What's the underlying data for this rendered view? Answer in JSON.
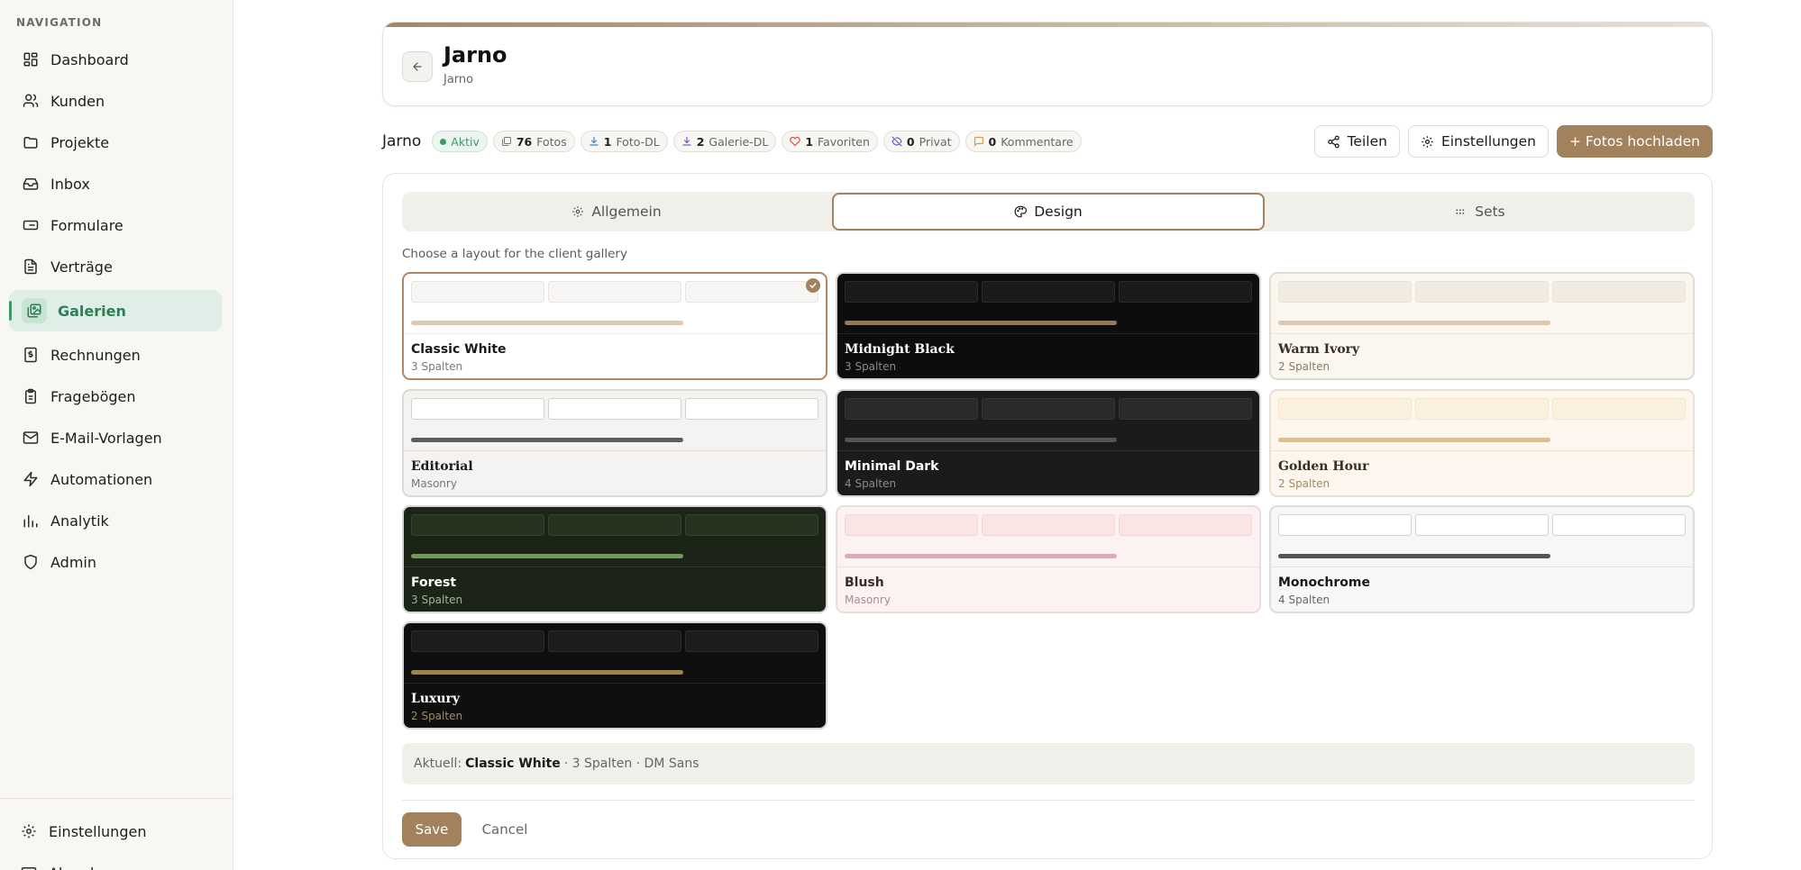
{
  "sidebar": {
    "heading": "NAVIGATION",
    "items": [
      {
        "label": "Dashboard",
        "icon": "dashboard-icon"
      },
      {
        "label": "Kunden",
        "icon": "users-icon"
      },
      {
        "label": "Projekte",
        "icon": "folder-icon"
      },
      {
        "label": "Inbox",
        "icon": "inbox-icon"
      },
      {
        "label": "Formulare",
        "icon": "form-icon"
      },
      {
        "label": "Verträge",
        "icon": "document-icon"
      },
      {
        "label": "Galerien",
        "icon": "gallery-icon",
        "active": true
      },
      {
        "label": "Rechnungen",
        "icon": "invoice-icon"
      },
      {
        "label": "Fragebögen",
        "icon": "clipboard-icon"
      },
      {
        "label": "E-Mail-Vorlagen",
        "icon": "mail-icon"
      },
      {
        "label": "Automationen",
        "icon": "lightning-icon"
      },
      {
        "label": "Analytik",
        "icon": "chart-icon"
      },
      {
        "label": "Admin",
        "icon": "shield-icon"
      }
    ],
    "bottom_items": [
      {
        "label": "Einstellungen",
        "icon": "gear-icon"
      },
      {
        "label": "Abrechnung",
        "icon": "billing-icon"
      }
    ]
  },
  "header": {
    "title": "Jarno",
    "subtitle": "Jarno"
  },
  "gallery": {
    "name": "Jarno",
    "status": "Aktiv",
    "stats": [
      {
        "count": "76",
        "label": "Fotos",
        "icon": "photos-icon",
        "color": "#777777"
      },
      {
        "count": "1",
        "label": "Foto-DL",
        "icon": "download-icon",
        "color": "#4a7fc7"
      },
      {
        "count": "2",
        "label": "Galerie-DL",
        "icon": "download-icon",
        "color": "#7a5fc0"
      },
      {
        "count": "1",
        "label": "Favoriten",
        "icon": "heart-icon",
        "color": "#d9534f"
      },
      {
        "count": "0",
        "label": "Privat",
        "icon": "eye-off-icon",
        "color": "#6a5fc0"
      },
      {
        "count": "0",
        "label": "Kommentare",
        "icon": "comment-icon",
        "color": "#d4a04a"
      }
    ]
  },
  "actions": {
    "share": "Teilen",
    "settings": "Einstellungen",
    "upload": "+ Fotos hochladen"
  },
  "tabs": [
    {
      "label": "Allgemein",
      "icon": "gear-icon"
    },
    {
      "label": "Design",
      "icon": "palette-icon",
      "active": true
    },
    {
      "label": "Sets",
      "icon": "grid-icon"
    }
  ],
  "design": {
    "hint": "Choose a layout for the client gallery",
    "themes": [
      {
        "name": "Classic White",
        "sub": "3 Spalten",
        "selected": true,
        "serif": false,
        "bg": "#ffffff",
        "cell": "#f6f5f3",
        "cell_border": "#e8e5e0",
        "bar": "#dcc9b3",
        "text": "#1a1a1a",
        "subtext": "#777777",
        "border": "#b08764",
        "divider": "#eeeeee"
      },
      {
        "name": "Midnight Black",
        "sub": "3 Spalten",
        "serif": true,
        "bg": "#0d0d0d",
        "cell": "#1a1a1a",
        "cell_border": "#2a2a2a",
        "bar": "#8f7a5c",
        "text": "#ffffff",
        "subtext": "#8a8a8a",
        "border": "#d6d6d6",
        "divider": "#262626"
      },
      {
        "name": "Warm Ivory",
        "sub": "2 Spalten",
        "serif": true,
        "bg": "#faf6f0",
        "cell": "#f1ebe1",
        "cell_border": "#e9e1d4",
        "bar": "#dbc8b0",
        "text": "#3a2e22",
        "subtext": "#8a7a66",
        "border": "#e1dccf",
        "divider": "#ece5d9"
      },
      {
        "name": "Editorial",
        "sub": "Masonry",
        "serif": true,
        "bg": "#f4f3f1",
        "cell": "#ffffff",
        "cell_border": "#d6d3ce",
        "bar": "#5e5e5e",
        "text": "#1a1a1a",
        "subtext": "#777777",
        "border": "#dddad4",
        "divider": "#e3e0da"
      },
      {
        "name": "Minimal Dark",
        "sub": "4 Spalten",
        "serif": false,
        "bg": "#1b1b1b",
        "cell": "#2a2a2a",
        "cell_border": "#363636",
        "bar": "#555555",
        "text": "#ffffff",
        "subtext": "#8a8a8a",
        "border": "#d6d6d6",
        "divider": "#303030"
      },
      {
        "name": "Golden Hour",
        "sub": "2 Spalten",
        "serif": true,
        "bg": "#fcf6ee",
        "cell": "#fbf0dd",
        "cell_border": "#f1e4ca",
        "bar": "#d8c090",
        "text": "#3a2e22",
        "subtext": "#a08a66",
        "border": "#e8e0d1",
        "divider": "#efe5d3"
      },
      {
        "name": "Forest",
        "sub": "3 Spalten",
        "serif": false,
        "bg": "#1b2417",
        "cell": "#26331f",
        "cell_border": "#34432c",
        "bar": "#6f9a57",
        "text": "#ffffff",
        "subtext": "#a3b39a",
        "border": "#d6d6d6",
        "divider": "#2d3a26"
      },
      {
        "name": "Blush",
        "sub": "Masonry",
        "serif": false,
        "bg": "#fcf2f2",
        "cell": "#fae4e4",
        "cell_border": "#f3d6d6",
        "bar": "#e2aab0",
        "text": "#3a2a2a",
        "subtext": "#b08a8a",
        "border": "#e9dcdc",
        "divider": "#f0e0e0"
      },
      {
        "name": "Monochrome",
        "sub": "4 Spalten",
        "serif": false,
        "bg": "#f7f7f7",
        "cell": "#ffffff",
        "cell_border": "#d4d4d4",
        "bar": "#555555",
        "text": "#1a1a1a",
        "subtext": "#666666",
        "border": "#dddddd",
        "divider": "#e3e3e3"
      },
      {
        "name": "Luxury",
        "sub": "2 Spalten",
        "serif": true,
        "bg": "#0f0f0f",
        "cell": "#1c1c1c",
        "cell_border": "#2a2a2a",
        "bar": "#9b8450",
        "text": "#ffffff",
        "subtext": "#9a8a6a",
        "border": "#d6d6d6",
        "divider": "#262626"
      }
    ],
    "current_prefix": "Aktuell:",
    "current_name": "Classic White",
    "current_details": "· 3 Spalten · DM Sans"
  },
  "footer": {
    "save": "Save",
    "cancel": "Cancel"
  }
}
